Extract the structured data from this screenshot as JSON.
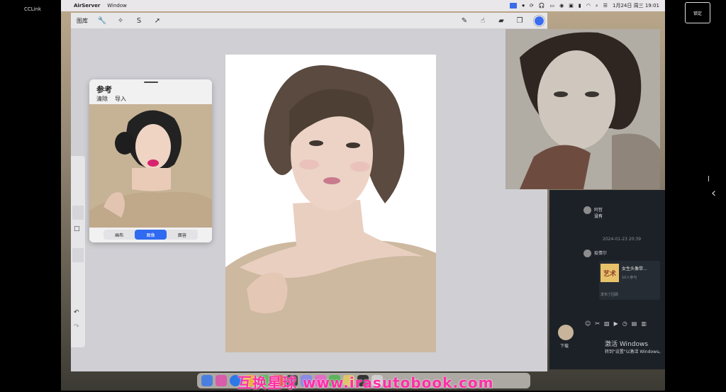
{
  "left_title": "CCLink",
  "menubar": {
    "apple": "",
    "app_name": "AirServer",
    "menu_window": "Window",
    "datetime": "1月24日 周三  19:01"
  },
  "toolbar": {
    "gallery": "图库",
    "tools": [
      "wrench-icon",
      "magic-wand-icon",
      "selection-s-icon",
      "transform-arrow-icon"
    ],
    "right_tools": [
      "brush-icon",
      "smudge-icon",
      "eraser-icon",
      "layers-icon"
    ],
    "color": "#3a6cf0"
  },
  "reference": {
    "title": "参考",
    "action_clear": "清除",
    "action_import": "导入",
    "tabs": [
      "画布",
      "图像",
      "面容"
    ],
    "selected_tab": "图像"
  },
  "rail": {
    "undo": "↶",
    "redo": "↷"
  },
  "chat": {
    "msg1_name": "阿哲",
    "msg1_text": "没有",
    "timestamp": "2024-01-23 20:39",
    "msg2_name": "疫情尔",
    "card_title": "女生头像带...",
    "card_sub": "10人参与",
    "card_tile_text": "艺术",
    "card_footer": "发布了回顾",
    "self_label": "下载",
    "activate_title": "激活 Windows",
    "activate_sub": "转到\"设置\"以激活 Windows。"
  },
  "top_right_button": "锁定",
  "watermark": "互换星球 www.irasutobook.com"
}
